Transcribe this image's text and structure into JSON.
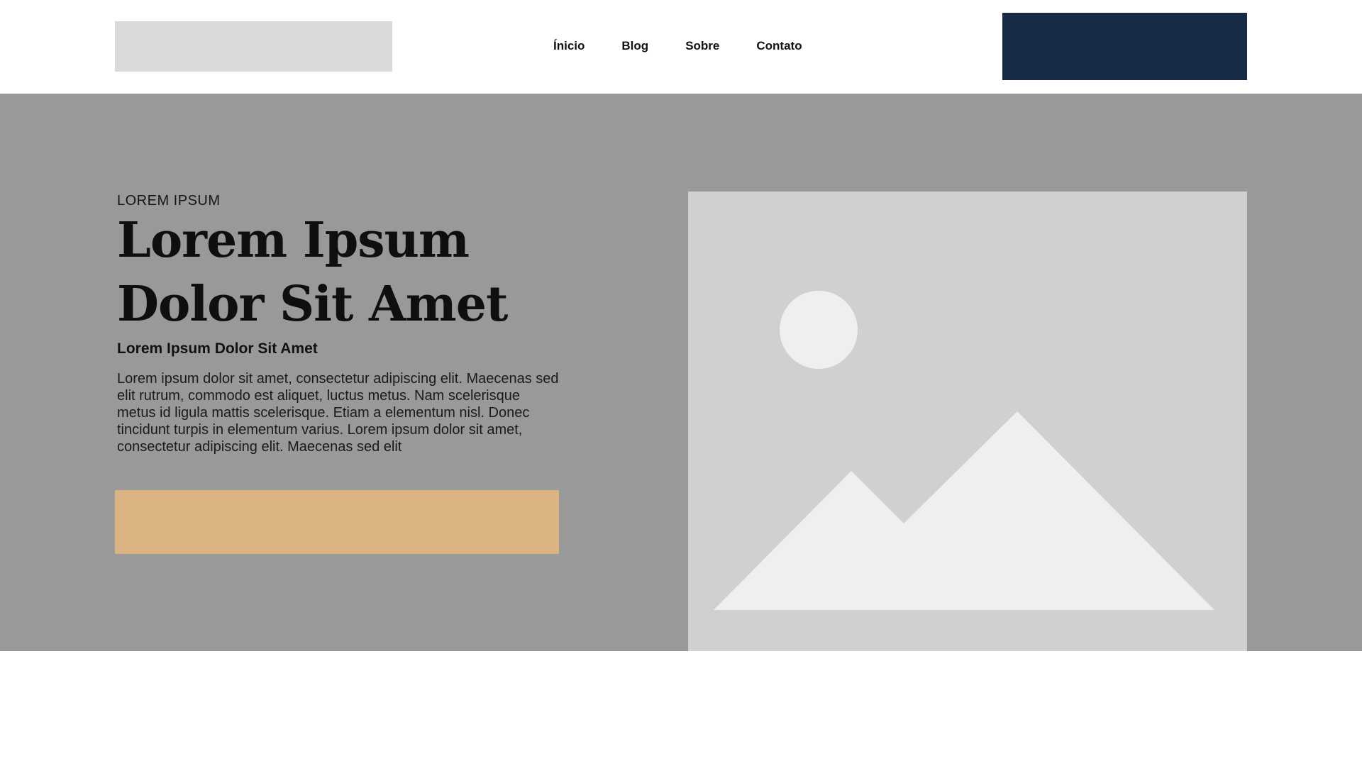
{
  "header": {
    "logo_icon": "logo-placeholder",
    "nav": [
      {
        "label": "Ínicio"
      },
      {
        "label": "Blog"
      },
      {
        "label": "Sobre"
      },
      {
        "label": "Contato"
      }
    ],
    "cta_color": "#172b46"
  },
  "hero": {
    "background": "#999999",
    "eyebrow": "LOREM IPSUM",
    "headline_line1": "Lorem Ipsum",
    "headline_line2": "Dolor Sit Amet",
    "subheadline": "Lorem Ipsum Dolor Sit Amet",
    "body": "Lorem ipsum dolor sit amet, consectetur adipiscing elit. Maecenas sed elit rutrum, commodo est aliquet, luctus metus. Nam scelerisque metus id ligula mattis scelerisque. Etiam a elementum nisl. Donec tincidunt turpis in elementum varius. Lorem ipsum dolor sit amet, consectetur adipiscing elit. Maecenas sed elit",
    "cta_color": "#dbb282",
    "image_icon": "image-placeholder-icon"
  }
}
